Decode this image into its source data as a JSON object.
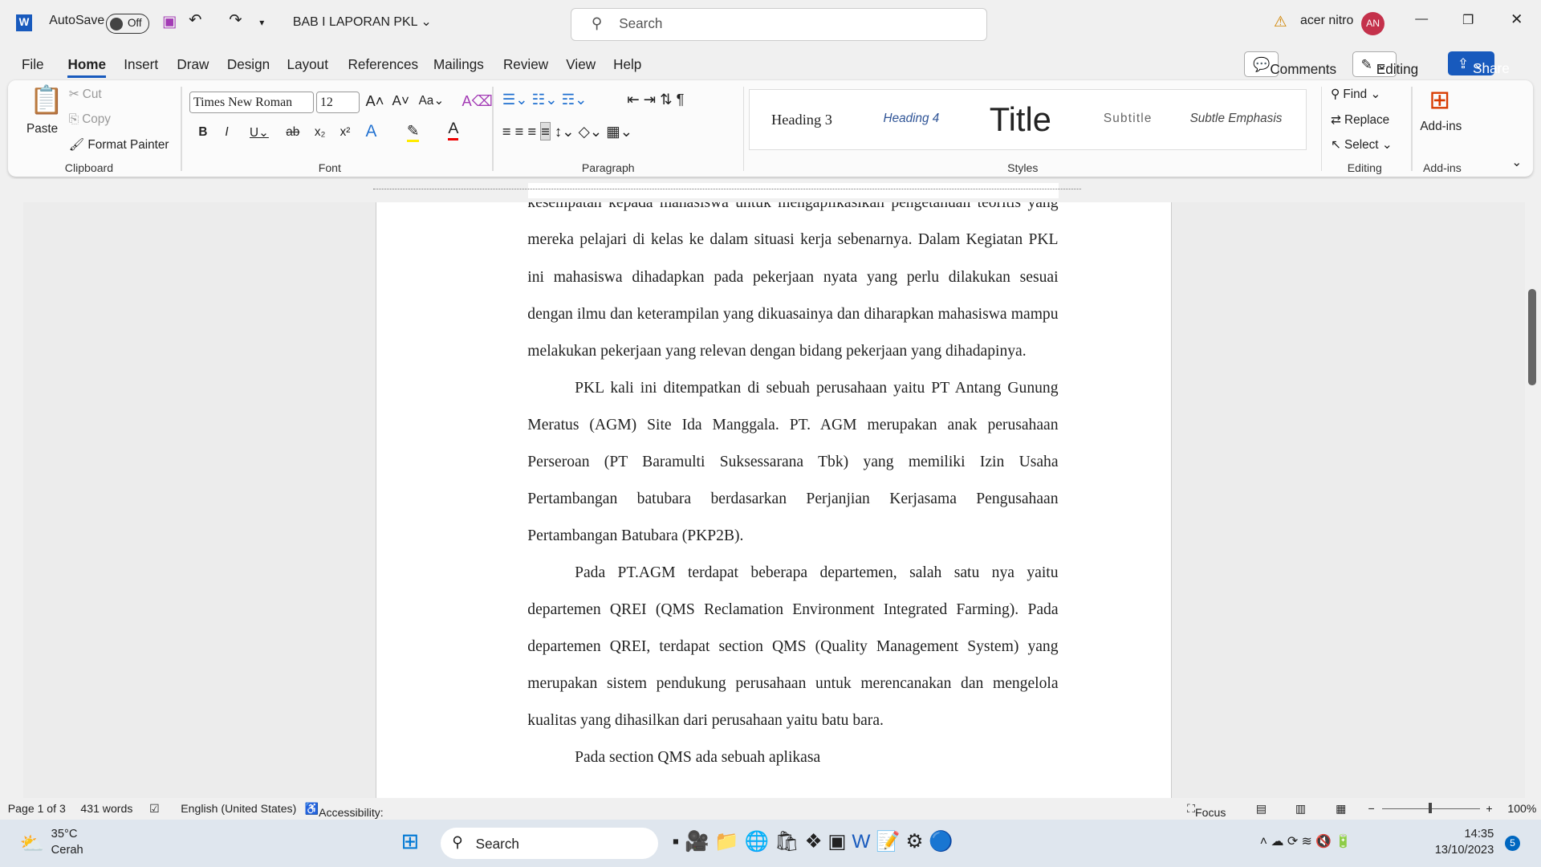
{
  "titlebar": {
    "autosave": "AutoSave",
    "toggle": "Off",
    "doc_title": "BAB I LAPORAN PKL",
    "search_placeholder": "Search",
    "user": "acer nitro",
    "avatar": "AN"
  },
  "menu": {
    "tabs": [
      "File",
      "Home",
      "Insert",
      "Draw",
      "Design",
      "Layout",
      "References",
      "Mailings",
      "Review",
      "View",
      "Help"
    ],
    "comments": "Comments",
    "editing": "Editing",
    "share": "Share"
  },
  "ribbon": {
    "paste": "Paste",
    "cut": "Cut",
    "copy": "Copy",
    "format_painter": "Format Painter",
    "font": "Times New Roman",
    "size": "12",
    "styles": [
      "Heading 3",
      "Heading 4",
      "Title",
      "Subtitle",
      "Subtle Emphasis"
    ],
    "find": "Find",
    "replace": "Replace",
    "select": "Select",
    "addins": "Add-ins",
    "groups": [
      "Clipboard",
      "Font",
      "Paragraph",
      "Styles",
      "Editing",
      "Add-ins"
    ]
  },
  "document": {
    "lines": [
      "kesempatan kepada mahasiswa untuk mengaplikasikan pengetahuan teoritis yang",
      "mereka pelajari di kelas ke dalam situasi kerja sebenarnya. Dalam Kegiatan PKL",
      "ini mahasiswa dihadapkan pada pekerjaan nyata yang perlu dilakukan sesuai",
      "dengan ilmu dan keterampilan yang dikuasainya dan diharapkan mahasiswa mampu",
      "melakukan pekerjaan yang relevan dengan bidang pekerjaan yang dihadapinya.",
      "PKL kali ini ditempatkan di sebuah perusahaan yaitu PT Antang Gunung",
      "Meratus (AGM) Site Ida Manggala. PT. AGM merupakan anak perusahaan",
      "Perseroan (PT Baramulti Suksessarana Tbk) yang memiliki Izin Usaha",
      "Pertambangan batubara berdasarkan Perjanjian Kerjasama Pengusahaan",
      "Pertambangan Batubara (PKP2B).",
      "Pada PT.AGM terdapat beberapa departemen, salah satu nya yaitu",
      "departemen QREI (QMS Reclamation Environment Integrated Farming). Pada",
      "departemen QREI, terdapat section QMS (Quality Management System) yang",
      "merupakan sistem pendukung perusahaan untuk merencanakan dan mengelola",
      "kualitas yang dihasilkan dari perusahaan yaitu batu bara.",
      "Pada section QMS ada sebuah aplikasa"
    ]
  },
  "status": {
    "page": "Page 1 of 3",
    "words": "431 words",
    "language": "English (United States)",
    "accessibility": "Accessibility: Good to go",
    "focus": "Focus",
    "zoom": "100%"
  },
  "taskbar": {
    "temp": "35°C",
    "weather": "Cerah",
    "search": "Search",
    "time": "14:35",
    "date": "13/10/2023",
    "badge": "5"
  }
}
